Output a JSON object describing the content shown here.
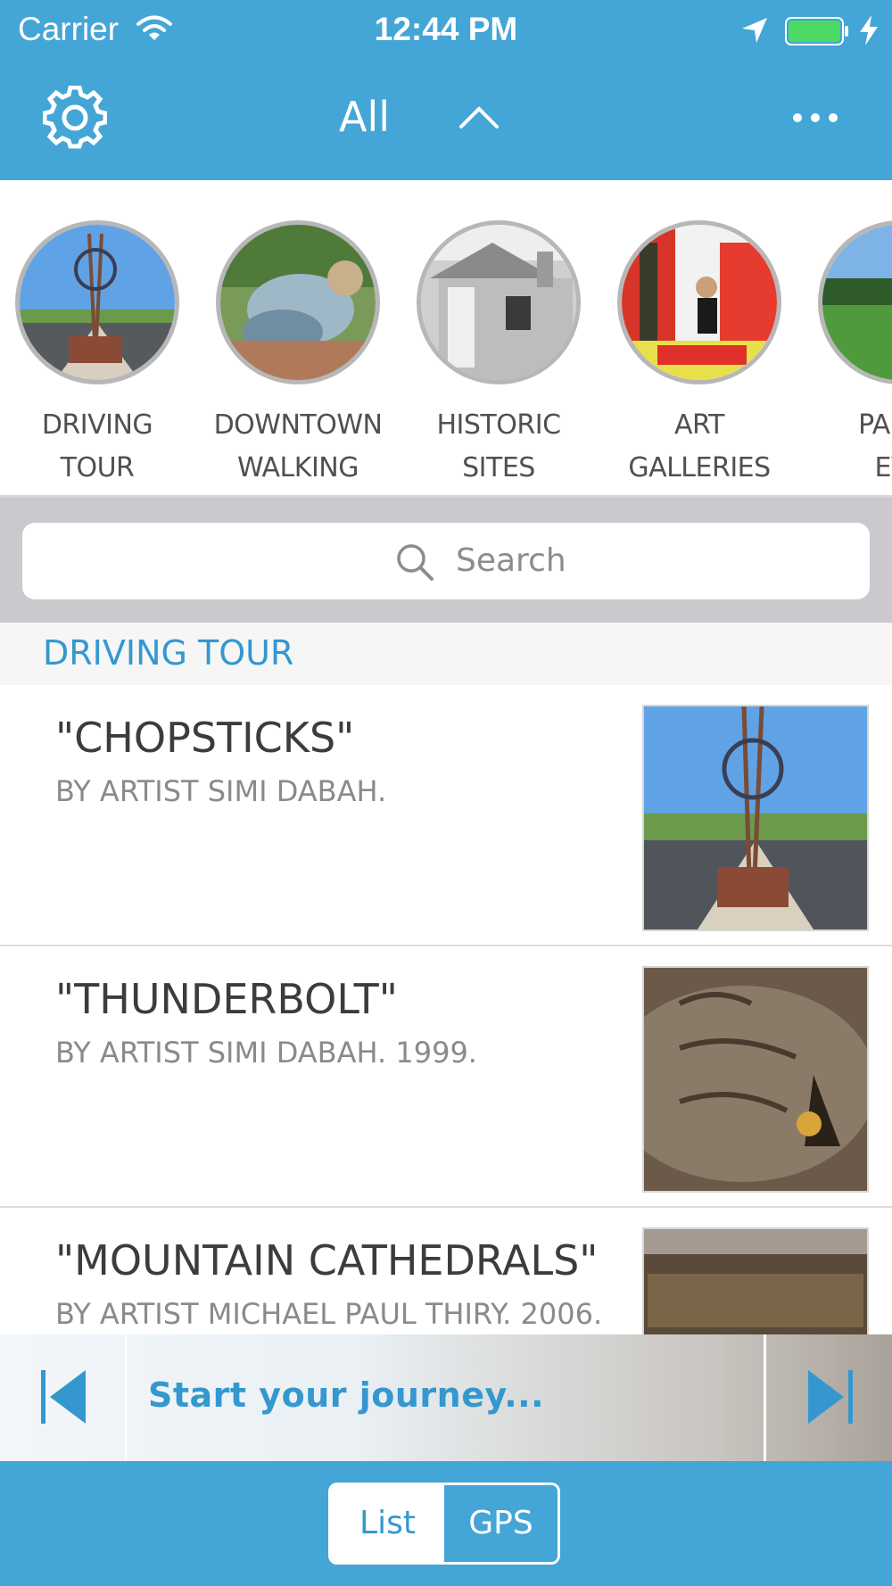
{
  "status_bar": {
    "carrier": "Carrier",
    "time": "12:44 PM",
    "battery_color": "#4cd964"
  },
  "nav": {
    "title": "All",
    "settings_icon": "gear-icon",
    "expand_icon": "chevron-up-icon",
    "more_icon": "ellipsis-icon"
  },
  "categories": [
    {
      "label": "DRIVING TOUR"
    },
    {
      "label": "DOWNTOWN\nWALKING TOUR"
    },
    {
      "label": "HISTORIC SITES"
    },
    {
      "label": "ART GALLERIES"
    },
    {
      "label": "PARKS\nEVE"
    }
  ],
  "search": {
    "placeholder": "Search"
  },
  "section": {
    "title": "DRIVING TOUR"
  },
  "items": [
    {
      "title": "\"CHOPSTICKS\"",
      "subtitle": "BY ARTIST SIMI DABAH."
    },
    {
      "title": "\"THUNDERBOLT\"",
      "subtitle": "BY ARTIST SIMI DABAH.  1999."
    },
    {
      "title": "\"MOUNTAIN CATHEDRALS\"",
      "subtitle": "BY ARTIST MICHAEL PAUL THIRY.  2006."
    }
  ],
  "player": {
    "prompt": "Start your journey..."
  },
  "view_toggle": {
    "list_label": "List",
    "gps_label": "GPS",
    "selected": "List"
  },
  "colors": {
    "brand": "#44a5d7",
    "accent_text": "#3498cf"
  }
}
